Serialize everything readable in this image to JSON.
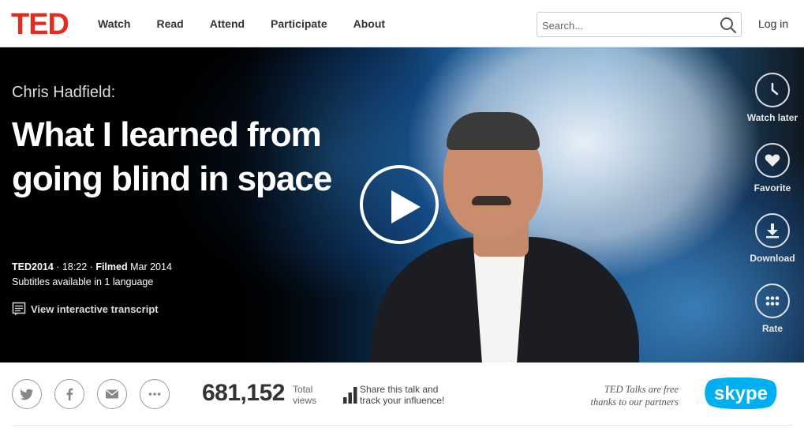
{
  "header": {
    "logo": "TED",
    "nav": [
      "Watch",
      "Read",
      "Attend",
      "Participate",
      "About"
    ],
    "search_placeholder": "Search...",
    "login": "Log in"
  },
  "talk": {
    "speaker": "Chris Hadfield:",
    "title": "What I learned from going blind in space",
    "event": "TED2014",
    "duration": "18:22",
    "filmed_label": "Filmed",
    "filmed_date": "Mar 2014",
    "subtitles": "Subtitles available in 1 language",
    "transcript_link": "View interactive transcript"
  },
  "actions": [
    {
      "label": "Watch later",
      "icon": "clock-icon"
    },
    {
      "label": "Favorite",
      "icon": "heart-icon"
    },
    {
      "label": "Download",
      "icon": "download-icon"
    },
    {
      "label": "Rate",
      "icon": "dots-grid-icon"
    }
  ],
  "stats": {
    "views": "681,152",
    "views_label_1": "Total",
    "views_label_2": "views",
    "share_line_1": "Share this talk and",
    "share_line_2": "track your influence!"
  },
  "partners": {
    "line_1": "TED Talks are free",
    "line_2": "thanks to our partners",
    "sponsor": "skype"
  },
  "colors": {
    "brand_red": "#e62b1e",
    "skype_blue": "#00aff0"
  }
}
